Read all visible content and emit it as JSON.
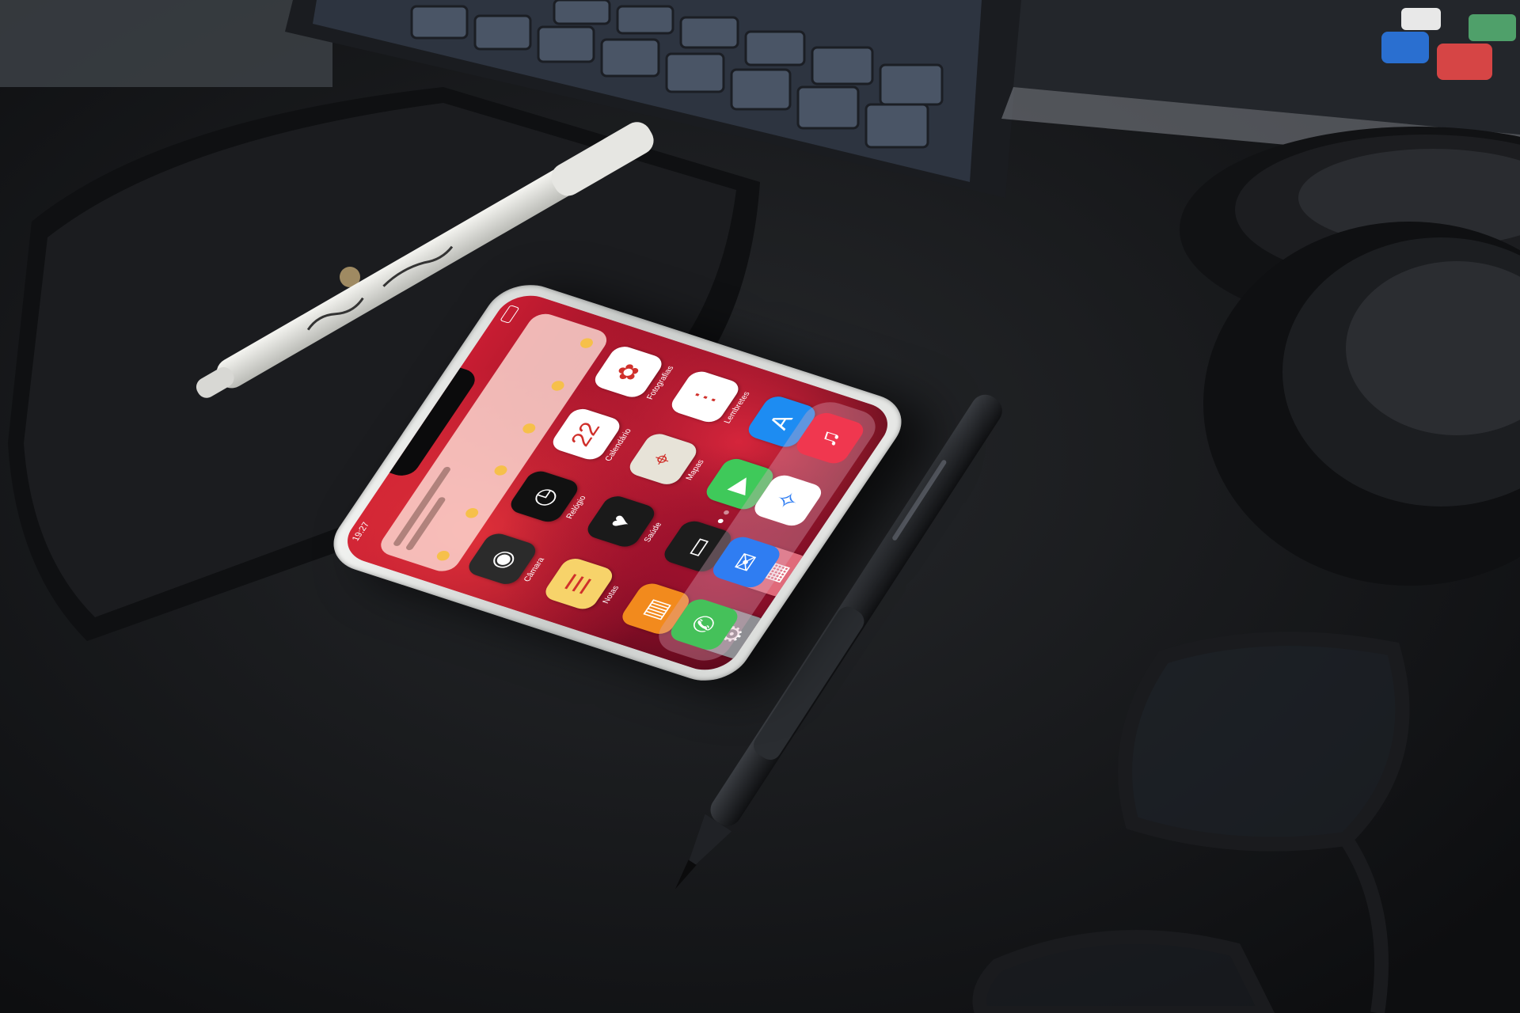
{
  "phone": {
    "status_time": "19:27",
    "apps": [
      {
        "label": "Câmara",
        "icon": "camera-icon",
        "glyph": "◉",
        "color": "#2b2b2b"
      },
      {
        "label": "Relógio",
        "icon": "clock-icon",
        "glyph": "◷",
        "color": "#111111"
      },
      {
        "label": "Calendário",
        "icon": "calendar-icon",
        "glyph": "22",
        "color": "#ffffff"
      },
      {
        "label": "Fotografias",
        "icon": "photos-icon",
        "glyph": "✿",
        "color": "#ffffff"
      },
      {
        "label": "Notas",
        "icon": "notes-icon",
        "glyph": "☰",
        "color": "#f7d36a"
      },
      {
        "label": "Saúde",
        "icon": "health-icon",
        "glyph": "♥",
        "color": "#1a1a1a"
      },
      {
        "label": "Mapas",
        "icon": "maps-icon",
        "glyph": "⌖",
        "color": "#e7e3d8"
      },
      {
        "label": "Lembretes",
        "icon": "reminders-icon",
        "glyph": "⋮",
        "color": "#ffffff"
      },
      {
        "label": "Livros",
        "icon": "books-icon",
        "glyph": "▥",
        "color": "#f28a1d"
      },
      {
        "label": "Wallet",
        "icon": "wallet-icon",
        "glyph": "▭",
        "color": "#1c1c1c"
      },
      {
        "label": "FaceTime",
        "icon": "facetime-icon",
        "glyph": "▶",
        "color": "#3fc95a"
      },
      {
        "label": "App Store",
        "icon": "app-store-icon",
        "glyph": "A",
        "color": "#1d8cf2"
      },
      {
        "label": "Definições",
        "icon": "settings-icon",
        "glyph": "⚙",
        "color": "#8e8e93"
      },
      {
        "label": "Outros",
        "icon": "folder-icon",
        "glyph": "▦",
        "color": "#e06a7a"
      }
    ],
    "dock": [
      {
        "icon": "phone-icon",
        "glyph": "✆",
        "color": "#45c15a"
      },
      {
        "icon": "mail-icon",
        "glyph": "✉",
        "color": "#2f7df2"
      },
      {
        "icon": "safari-icon",
        "glyph": "✧",
        "color": "#ffffff"
      },
      {
        "icon": "music-icon",
        "glyph": "♫",
        "color": "#f0374f"
      }
    ]
  }
}
